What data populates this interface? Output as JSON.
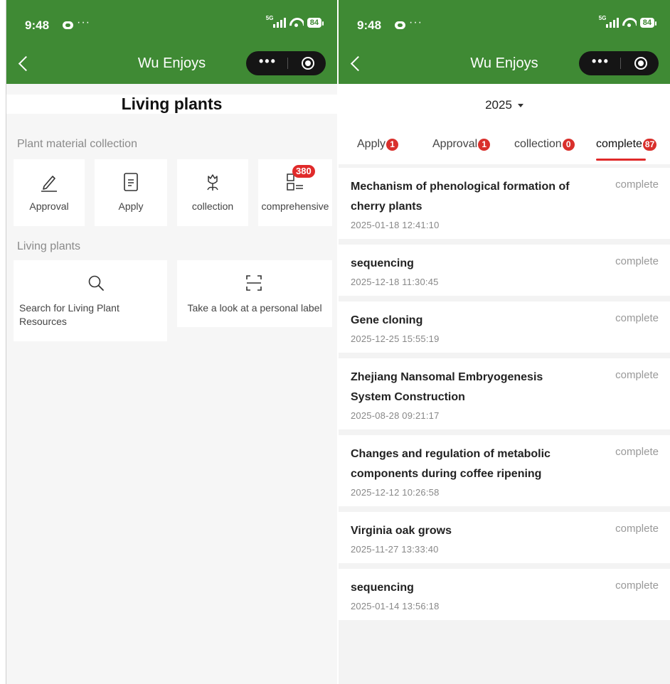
{
  "status_bar": {
    "time": "9:48",
    "dots": "···",
    "network": "5G",
    "battery": "84"
  },
  "nav": {
    "title": "Wu Enjoys",
    "more": "•••"
  },
  "left": {
    "page_title": "Living plants",
    "section1_title": "Plant material collection",
    "tiles": [
      {
        "label": "Approval",
        "icon": "pen-icon"
      },
      {
        "label": "Apply",
        "icon": "document-icon"
      },
      {
        "label": "collection",
        "icon": "flower-icon"
      },
      {
        "label": "comprehensive",
        "icon": "grid-list-icon",
        "badge": "380"
      }
    ],
    "section2_title": "Living plants",
    "cards": [
      {
        "label": "Search for Living Plant Resources",
        "icon": "search-icon"
      },
      {
        "label": "Take a look at a personal label",
        "icon": "scan-icon"
      }
    ]
  },
  "right": {
    "year": "2025",
    "tabs": [
      {
        "label": "Apply",
        "count": "1"
      },
      {
        "label": "Approval",
        "count": "1"
      },
      {
        "label": "collection",
        "count": "0"
      },
      {
        "label": "complete",
        "count": "87"
      }
    ],
    "items": [
      {
        "title": "Mechanism of phenological formation of cherry plants",
        "time": "2025-01-18 12:41:10",
        "status": "complete"
      },
      {
        "title": "sequencing",
        "time": "2025-12-18 11:30:45",
        "status": "complete"
      },
      {
        "title": "Gene cloning",
        "time": "2025-12-25 15:55:19",
        "status": "complete"
      },
      {
        "title": "Zhejiang Nansomal Embryogenesis System Construction",
        "time": "2025-08-28 09:21:17",
        "status": "complete"
      },
      {
        "title": "Changes and regulation of metabolic components during coffee ripening",
        "time": "2025-12-12 10:26:58",
        "status": "complete"
      },
      {
        "title": "Virginia oak grows",
        "time": "2025-11-27 13:33:40",
        "status": "complete"
      },
      {
        "title": "sequencing",
        "time": "2025-01-14 13:56:18",
        "status": "complete"
      }
    ]
  },
  "colors": {
    "header_green": "#3f8a34",
    "badge_red": "#e02a2a",
    "capsule": "#151515"
  }
}
